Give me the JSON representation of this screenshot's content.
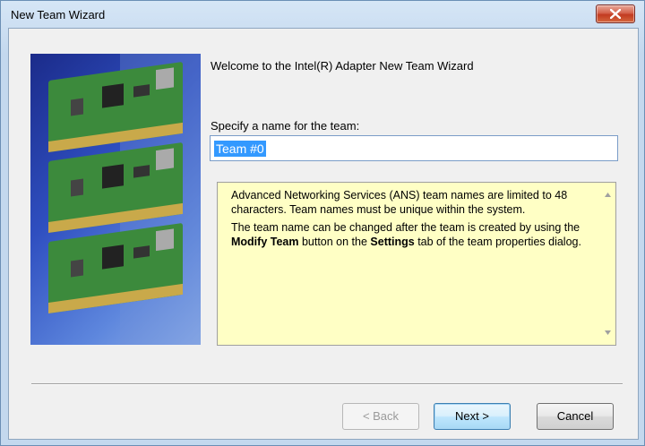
{
  "window": {
    "title": "New Team Wizard"
  },
  "welcome_text": "Welcome to the Intel(R) Adapter New Team Wizard",
  "name_field": {
    "label": "Specify a name for the team:",
    "value": "Team #0"
  },
  "info": {
    "paragraph1": "Advanced Networking Services (ANS) team names are limited to 48 characters. Team names must be unique within the system.",
    "p2_before": "The team name can be changed after the team is created by using the ",
    "p2_bold1": "Modify Team",
    "p2_middle": " button on the ",
    "p2_bold2": "Settings",
    "p2_after": " tab of the team properties dialog."
  },
  "buttons": {
    "back": "< Back",
    "next": "Next >",
    "cancel": "Cancel"
  },
  "icons": {
    "close": "close-icon",
    "scroll_up": "scroll-up-arrow-icon",
    "scroll_down": "scroll-down-arrow-icon"
  }
}
